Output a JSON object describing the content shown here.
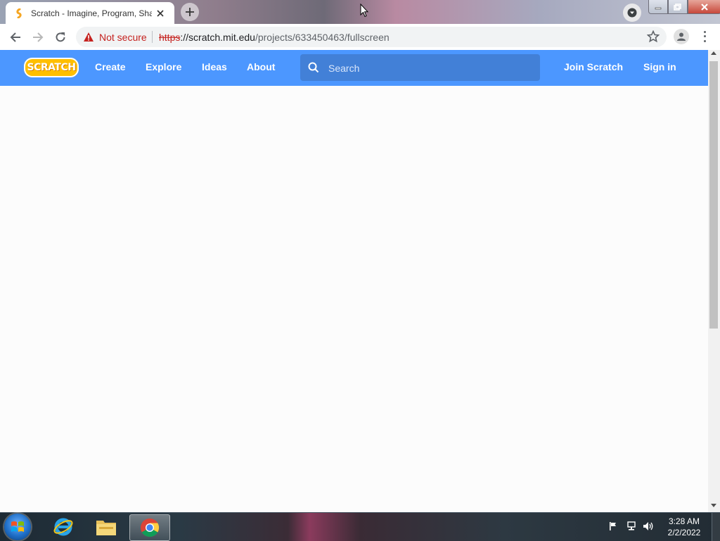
{
  "browser": {
    "tab": {
      "title": "Scratch - Imagine, Program, Share"
    },
    "address": {
      "security_label": "Not secure",
      "url_scheme": "https",
      "url_host": "://scratch.mit.edu",
      "url_path": "/projects/633450463/fullscreen"
    }
  },
  "scratch": {
    "logo_text": "SCRATCH",
    "nav": [
      "Create",
      "Explore",
      "Ideas",
      "About"
    ],
    "search_placeholder": "Search",
    "join_label": "Join Scratch",
    "signin_label": "Sign in"
  },
  "taskbar": {
    "time": "3:28 AM",
    "date": "2/2/2022"
  },
  "colors": {
    "scratch_blue": "#4c97ff",
    "scratch_search": "#4280d7",
    "logo_orange": "#ffbf00",
    "insecure_red": "#c5221f"
  }
}
